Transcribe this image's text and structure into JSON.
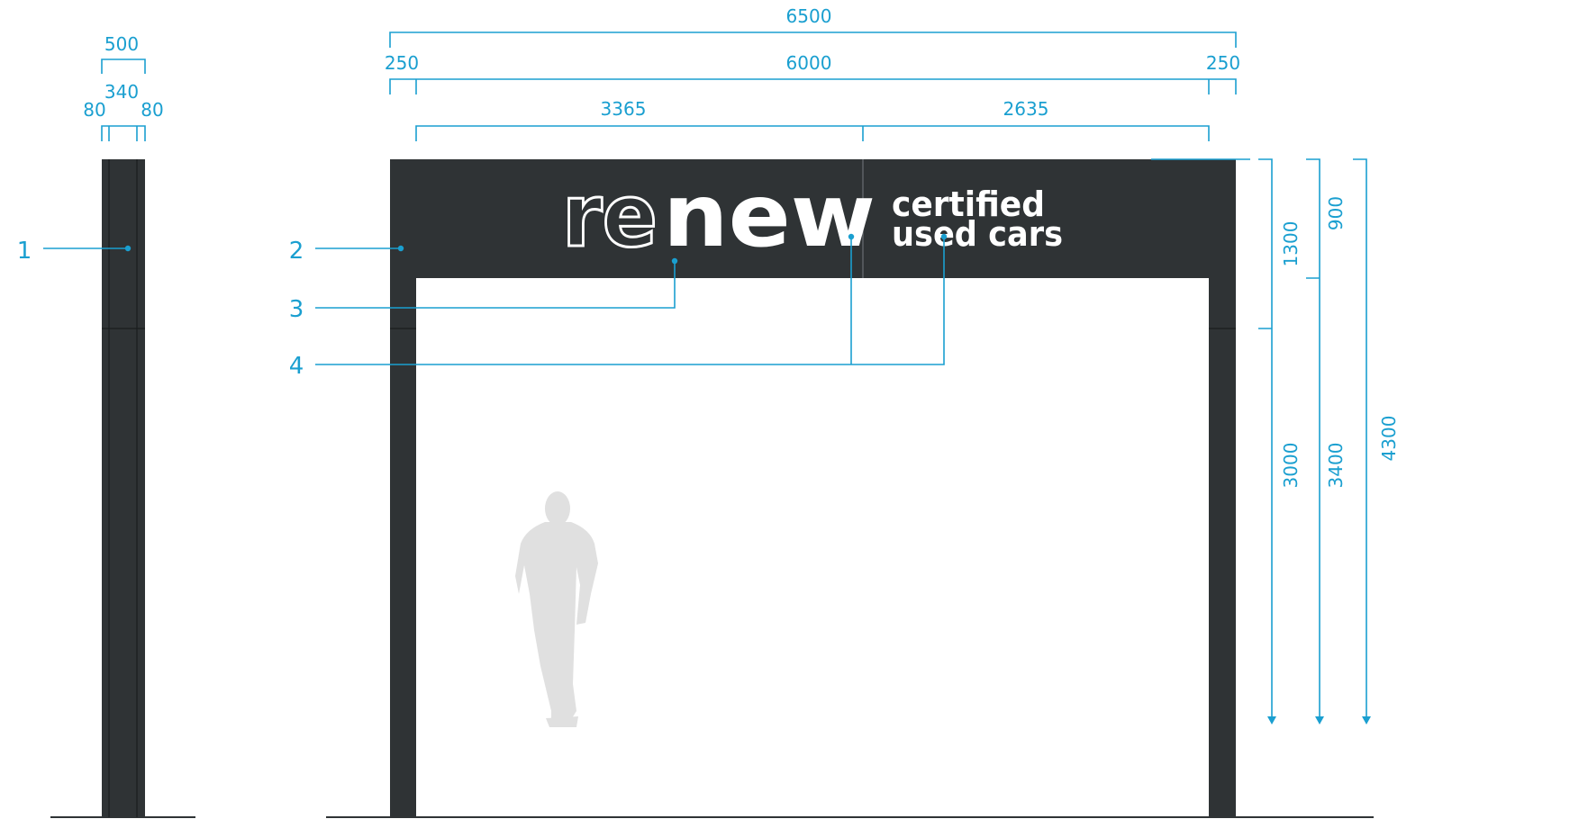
{
  "dimensions": {
    "side_total": "500",
    "side_core": "340",
    "side_left_edge": "80",
    "side_right_edge": "80",
    "front_total": "6500",
    "front_left_post": "250",
    "front_span": "6000",
    "front_right_post": "250",
    "sign_left": "3365",
    "sign_right": "2635",
    "sign_height": "900",
    "header_height": "1300",
    "post_lower": "3000",
    "clearance": "3400",
    "overall_height": "4300"
  },
  "callouts": [
    "1",
    "2",
    "3",
    "4"
  ],
  "sign": {
    "brand_outline": "re",
    "brand_solid": "new",
    "tagline_line1": "certified",
    "tagline_line2": "used cars"
  },
  "colors": {
    "structure": "#2f3335",
    "dimension": "#1a9fd0",
    "figure": "#e0e0e0",
    "sign_text": "#ffffff"
  },
  "icons": {
    "figure": "person-silhouette-icon"
  }
}
